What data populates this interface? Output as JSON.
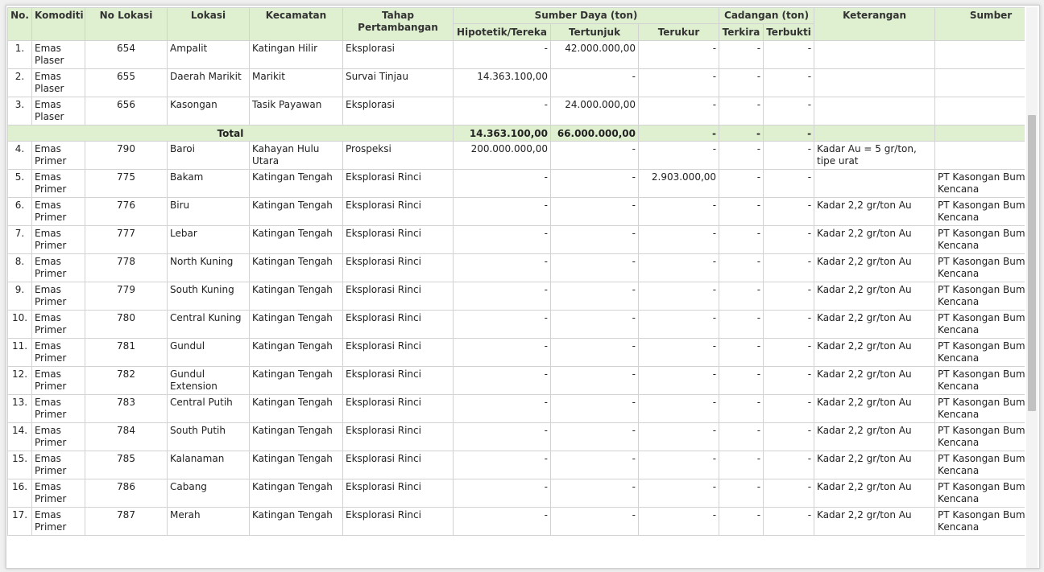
{
  "headers": {
    "no": "No.",
    "komoditi": "Komoditi",
    "no_lokasi": "No Lokasi",
    "lokasi": "Lokasi",
    "kecamatan": "Kecamatan",
    "tahap": "Tahap Pertambangan",
    "sumber_daya": "Sumber Daya (ton)",
    "cadangan": "Cadangan (ton)",
    "keterangan": "Keterangan",
    "sumber": "Sumber",
    "hipotetik": "Hipotetik/Tereka",
    "tertunjuk": "Tertunjuk",
    "terukur": "Terukur",
    "terkira": "Terkira",
    "terbukti": "Terbukti"
  },
  "rows_before_total": [
    {
      "no": "1.",
      "komoditi": "Emas Plaser",
      "no_lokasi": "654",
      "lokasi": "Ampalit",
      "kecamatan": "Katingan Hilir",
      "tahap": "Eksplorasi",
      "hipotetik": "-",
      "tertunjuk": "42.000.000,00",
      "terukur": "-",
      "terkira": "-",
      "terbukti": "-",
      "keterangan": "",
      "sumber": ""
    },
    {
      "no": "2.",
      "komoditi": "Emas Plaser",
      "no_lokasi": "655",
      "lokasi": "Daerah Marikit",
      "kecamatan": "Marikit",
      "tahap": "Survai Tinjau",
      "hipotetik": "14.363.100,00",
      "tertunjuk": "-",
      "terukur": "-",
      "terkira": "-",
      "terbukti": "-",
      "keterangan": "",
      "sumber": ""
    },
    {
      "no": "3.",
      "komoditi": "Emas Plaser",
      "no_lokasi": "656",
      "lokasi": "Kasongan",
      "kecamatan": "Tasik Payawan",
      "tahap": "Eksplorasi",
      "hipotetik": "-",
      "tertunjuk": "24.000.000,00",
      "terukur": "-",
      "terkira": "-",
      "terbukti": "-",
      "keterangan": "",
      "sumber": ""
    }
  ],
  "total": {
    "label": "Total",
    "hipotetik": "14.363.100,00",
    "tertunjuk": "66.000.000,00",
    "terukur": "-",
    "terkira": "-",
    "terbukti": "-"
  },
  "rows_after_total": [
    {
      "no": "4.",
      "komoditi": "Emas Primer",
      "no_lokasi": "790",
      "lokasi": "Baroi",
      "kecamatan": "Kahayan Hulu Utara",
      "tahap": "Prospeksi",
      "hipotetik": "200.000.000,00",
      "tertunjuk": "-",
      "terukur": "-",
      "terkira": "-",
      "terbukti": "-",
      "keterangan": "Kadar Au = 5 gr/ton, tipe urat",
      "sumber": ""
    },
    {
      "no": "5.",
      "komoditi": "Emas Primer",
      "no_lokasi": "775",
      "lokasi": "Bakam",
      "kecamatan": "Katingan Tengah",
      "tahap": "Eksplorasi Rinci",
      "hipotetik": "-",
      "tertunjuk": "-",
      "terukur": "2.903.000,00",
      "terkira": "-",
      "terbukti": "-",
      "keterangan": "",
      "sumber": "PT Kasongan Bumi Kencana"
    },
    {
      "no": "6.",
      "komoditi": "Emas Primer",
      "no_lokasi": "776",
      "lokasi": "Biru",
      "kecamatan": "Katingan Tengah",
      "tahap": "Eksplorasi Rinci",
      "hipotetik": "-",
      "tertunjuk": "-",
      "terukur": "-",
      "terkira": "-",
      "terbukti": "-",
      "keterangan": "Kadar 2,2 gr/ton Au",
      "sumber": "PT Kasongan Bumi Kencana"
    },
    {
      "no": "7.",
      "komoditi": "Emas Primer",
      "no_lokasi": "777",
      "lokasi": "Lebar",
      "kecamatan": "Katingan Tengah",
      "tahap": "Eksplorasi Rinci",
      "hipotetik": "-",
      "tertunjuk": "-",
      "terukur": "-",
      "terkira": "-",
      "terbukti": "-",
      "keterangan": "Kadar 2,2 gr/ton Au",
      "sumber": "PT Kasongan Bumi Kencana"
    },
    {
      "no": "8.",
      "komoditi": "Emas Primer",
      "no_lokasi": "778",
      "lokasi": "North Kuning",
      "kecamatan": "Katingan Tengah",
      "tahap": "Eksplorasi Rinci",
      "hipotetik": "-",
      "tertunjuk": "-",
      "terukur": "-",
      "terkira": "-",
      "terbukti": "-",
      "keterangan": "Kadar 2,2 gr/ton Au",
      "sumber": "PT Kasongan Bumi Kencana"
    },
    {
      "no": "9.",
      "komoditi": "Emas Primer",
      "no_lokasi": "779",
      "lokasi": "South Kuning",
      "kecamatan": "Katingan Tengah",
      "tahap": "Eksplorasi Rinci",
      "hipotetik": "-",
      "tertunjuk": "-",
      "terukur": "-",
      "terkira": "-",
      "terbukti": "-",
      "keterangan": "Kadar 2,2 gr/ton Au",
      "sumber": "PT Kasongan Bumi Kencana"
    },
    {
      "no": "10.",
      "komoditi": "Emas Primer",
      "no_lokasi": "780",
      "lokasi": "Central Kuning",
      "kecamatan": "Katingan Tengah",
      "tahap": "Eksplorasi Rinci",
      "hipotetik": "-",
      "tertunjuk": "-",
      "terukur": "-",
      "terkira": "-",
      "terbukti": "-",
      "keterangan": "Kadar 2,2 gr/ton Au",
      "sumber": "PT Kasongan Bumi Kencana"
    },
    {
      "no": "11.",
      "komoditi": "Emas Primer",
      "no_lokasi": "781",
      "lokasi": "Gundul",
      "kecamatan": "Katingan Tengah",
      "tahap": "Eksplorasi Rinci",
      "hipotetik": "-",
      "tertunjuk": "-",
      "terukur": "-",
      "terkira": "-",
      "terbukti": "-",
      "keterangan": "Kadar 2,2 gr/ton Au",
      "sumber": "PT Kasongan Bumi Kencana"
    },
    {
      "no": "12.",
      "komoditi": "Emas Primer",
      "no_lokasi": "782",
      "lokasi": "Gundul Extension",
      "kecamatan": "Katingan Tengah",
      "tahap": "Eksplorasi Rinci",
      "hipotetik": "-",
      "tertunjuk": "-",
      "terukur": "-",
      "terkira": "-",
      "terbukti": "-",
      "keterangan": "Kadar 2,2 gr/ton Au",
      "sumber": "PT Kasongan Bumi Kencana"
    },
    {
      "no": "13.",
      "komoditi": "Emas Primer",
      "no_lokasi": "783",
      "lokasi": "Central Putih",
      "kecamatan": "Katingan Tengah",
      "tahap": "Eksplorasi Rinci",
      "hipotetik": "-",
      "tertunjuk": "-",
      "terukur": "-",
      "terkira": "-",
      "terbukti": "-",
      "keterangan": "Kadar 2,2 gr/ton Au",
      "sumber": "PT Kasongan Bumi Kencana"
    },
    {
      "no": "14.",
      "komoditi": "Emas Primer",
      "no_lokasi": "784",
      "lokasi": "South Putih",
      "kecamatan": "Katingan Tengah",
      "tahap": "Eksplorasi Rinci",
      "hipotetik": "-",
      "tertunjuk": "-",
      "terukur": "-",
      "terkira": "-",
      "terbukti": "-",
      "keterangan": "Kadar 2,2 gr/ton Au",
      "sumber": "PT Kasongan Bumi Kencana"
    },
    {
      "no": "15.",
      "komoditi": "Emas Primer",
      "no_lokasi": "785",
      "lokasi": "Kalanaman",
      "kecamatan": "Katingan Tengah",
      "tahap": "Eksplorasi Rinci",
      "hipotetik": "-",
      "tertunjuk": "-",
      "terukur": "-",
      "terkira": "-",
      "terbukti": "-",
      "keterangan": "Kadar 2,2 gr/ton Au",
      "sumber": "PT Kasongan Bumi Kencana"
    },
    {
      "no": "16.",
      "komoditi": "Emas Primer",
      "no_lokasi": "786",
      "lokasi": "Cabang",
      "kecamatan": "Katingan Tengah",
      "tahap": "Eksplorasi Rinci",
      "hipotetik": "-",
      "tertunjuk": "-",
      "terukur": "-",
      "terkira": "-",
      "terbukti": "-",
      "keterangan": "Kadar 2,2 gr/ton Au",
      "sumber": "PT Kasongan Bumi Kencana"
    },
    {
      "no": "17.",
      "komoditi": "Emas Primer",
      "no_lokasi": "787",
      "lokasi": "Merah",
      "kecamatan": "Katingan Tengah",
      "tahap": "Eksplorasi Rinci",
      "hipotetik": "-",
      "tertunjuk": "-",
      "terukur": "-",
      "terkira": "-",
      "terbukti": "-",
      "keterangan": "Kadar 2,2 gr/ton Au",
      "sumber": "PT Kasongan Bumi Kencana"
    }
  ]
}
